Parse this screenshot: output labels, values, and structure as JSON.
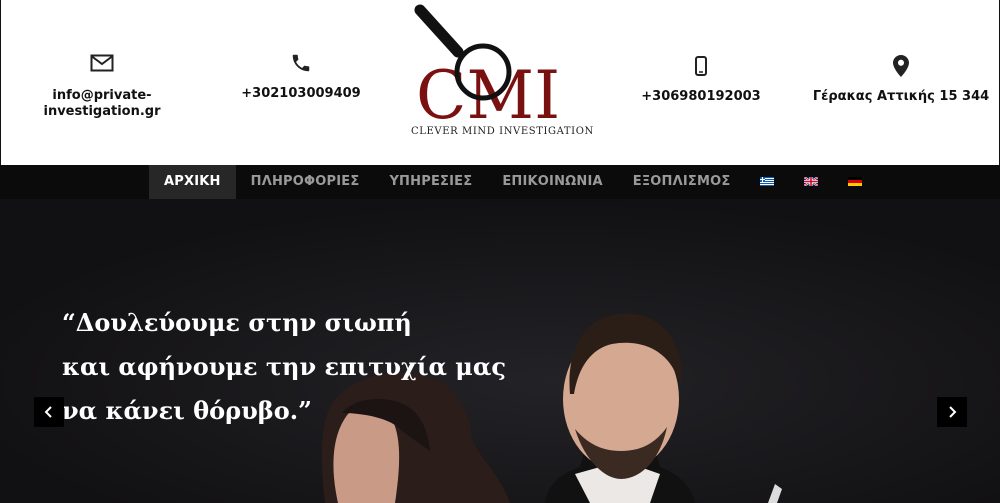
{
  "header": {
    "email": {
      "icon": "envelope-icon",
      "text": "info@private-\ninvestigation.gr"
    },
    "phone": {
      "icon": "phone-icon",
      "text": "+302103009409"
    },
    "mobile": {
      "icon": "mobile-phone-icon",
      "text": "+306980192003"
    },
    "address": {
      "icon": "map-marker-icon",
      "text": "Γέρακας Αττικής 15 344"
    },
    "logo": {
      "letters": "CMI",
      "tagline": "CLEVER MIND INVESTIGATION",
      "color": "#7a1111"
    }
  },
  "nav": {
    "items": [
      {
        "label": "ΑΡΧΙΚΗ",
        "active": true
      },
      {
        "label": "ΠΛΗΡΟΦΟΡΙΕΣ"
      },
      {
        "label": "ΥΠΗΡΕΣΙΕΣ"
      },
      {
        "label": "ΕΠΙΚΟΙΝΩΝΙΑ"
      },
      {
        "label": "ΕΞΟΠΛΙΣΜΟΣ"
      }
    ],
    "flags": [
      "greek-flag-icon",
      "english-flag-icon",
      "german-flag-icon"
    ]
  },
  "hero": {
    "quote_line1": "“Δουλεύουμε στην σιωπή",
    "quote_line2": "και αφήνουμε την επιτυχία μας",
    "quote_line3": "να κάνει θόρυβο.”"
  }
}
